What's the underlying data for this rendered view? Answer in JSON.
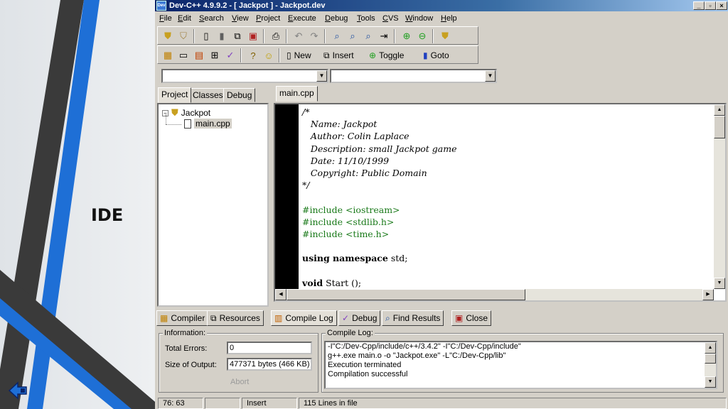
{
  "slide": {
    "title": "IDE"
  },
  "window": {
    "title": "Dev-C++ 4.9.9.2  - [ Jackpot ] - Jackpot.dev",
    "icon_text": "Dev",
    "controls": {
      "minimize": "_",
      "maximize": "▫",
      "close": "×"
    }
  },
  "menu": [
    "File",
    "Edit",
    "Search",
    "View",
    "Project",
    "Execute",
    "Debug",
    "Tools",
    "CVS",
    "Window",
    "Help"
  ],
  "toolbar2": {
    "new_label": "New",
    "insert_label": "Insert",
    "toggle_label": "Toggle",
    "goto_label": "Goto"
  },
  "combos": {
    "class_value": "",
    "member_value": ""
  },
  "left_tabs": [
    "Project",
    "Classes",
    "Debug"
  ],
  "editor_tab": "main.cpp",
  "project_tree": {
    "root": "Jackpot",
    "file": "main.cpp",
    "expander": "−"
  },
  "code_lines": [
    "/*",
    "   Name: Jackpot",
    "   Author: Colin Laplace",
    "   Description: small Jackpot game",
    "   Date: 11/10/1999",
    "   Copyright: Public Domain",
    "*/",
    "",
    "#include <iostream>",
    "#include <stdlib.h>",
    "#include <time.h>",
    "",
    "using namespace std;",
    "",
    "void Start ();"
  ],
  "code_keywords": {
    "using_kw": "using namespace",
    "using_rest": " std;",
    "void_kw": "void",
    "void_rest": " Start ();"
  },
  "bottom_tabs": [
    "Compiler",
    "Resources",
    "Compile Log",
    "Debug",
    "Find Results",
    "Close"
  ],
  "information": {
    "title": "Information:",
    "total_errors_label": "Total Errors:",
    "total_errors_value": "0",
    "size_label": "Size of Output:",
    "size_value": "477371 bytes (466 KB)",
    "abort_label": "Abort"
  },
  "compile_log": {
    "title": "Compile Log:",
    "lines": [
      "-I\"C:/Dev-Cpp/include/c++/3.4.2\"  -I\"C:/Dev-Cpp/include\"",
      "g++.exe main.o  -o \"Jackpot.exe\" -L\"C:/Dev-Cpp/lib\"",
      "Execution terminated",
      "Compilation successful"
    ]
  },
  "status": {
    "position": "76: 63",
    "modified": "",
    "mode": "Insert",
    "lines": "115 Lines in file"
  },
  "colors": {
    "titlebar_start": "#0a246a",
    "titlebar_end": "#a6caf0",
    "preprocessor": "#1a7a1a",
    "stripe_blue": "#1e6fd6",
    "stripe_dark": "#3a3a3a"
  }
}
